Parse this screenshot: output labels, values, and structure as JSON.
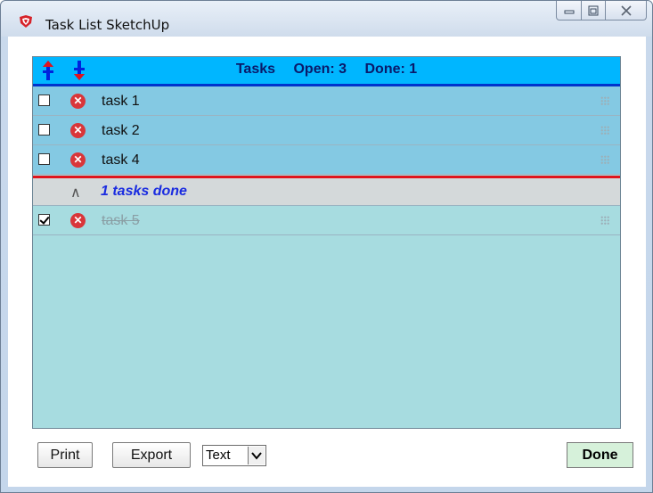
{
  "window": {
    "title": "Task List SketchUp",
    "minimize_glyph": "▭",
    "maximize_glyph": "▣",
    "close_glyph": "✕"
  },
  "header": {
    "title": "Tasks",
    "open_text": "Open: 3",
    "done_text": "Done: 1",
    "icons": [
      "move-up-icon",
      "move-down-icon"
    ]
  },
  "open_tasks": [
    {
      "name": "task 1",
      "checked": false
    },
    {
      "name": "task 2",
      "checked": false
    },
    {
      "name": "task 4",
      "checked": false
    }
  ],
  "done_section": {
    "caret": "∧",
    "label": "1 tasks done"
  },
  "done_tasks": [
    {
      "name": "task 5",
      "checked": true
    }
  ],
  "footer": {
    "print_label": "Print",
    "export_label": "Export",
    "format_selected": "Text",
    "done_label": "Done"
  },
  "colors": {
    "header_bg": "#00b6ff",
    "open_row_bg": "#84c9e3",
    "list_bg": "#a7dce0",
    "divider_line": "#e0141c",
    "done_label": "#1a2ce0",
    "delete_icon": "#d9363a"
  }
}
